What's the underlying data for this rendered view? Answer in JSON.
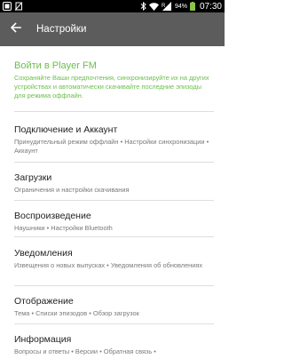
{
  "status_bar": {
    "time": "07:30",
    "battery_percent": "94%",
    "left_icons": [
      "notification-icon",
      "no-sim-icon"
    ],
    "right_icons": [
      "bluetooth-icon",
      "wifi-icon",
      "signal-icon",
      "battery-icon"
    ],
    "signal_roaming_mark": "R"
  },
  "app_bar": {
    "back_icon": "arrow-left-icon",
    "title": "Настройки"
  },
  "signin": {
    "title": "Войти в Player FM",
    "description": "Сохраняйте Ваши предпочтения, синхронизируйте их на других устройствах и автоматически скачивайте последние эпизоды для режима оффлайн."
  },
  "settings": [
    {
      "title": "Подключение и Аккаунт",
      "subtitle": "Принудительный режим оффлайн • Настройки синхронизации • Аккаунт"
    },
    {
      "title": "Загрузки",
      "subtitle": "Ограничения и настройки скачивания"
    },
    {
      "title": "Воспроизведение",
      "subtitle": "Наушники • Настройки Bluetooth"
    },
    {
      "title": "Уведомления",
      "subtitle": "Извещения о новых выпусках • Уведомления об обновлениях"
    },
    {
      "title": "Отображение",
      "subtitle": "Тема • Списки эпизодов • Обзор загрузок"
    },
    {
      "title": "Информация",
      "subtitle": "Вопросы и ответы • Версии • Обратная связь •"
    }
  ],
  "colors": {
    "accent": "#6bc04b",
    "app_bar": "#5c5c5c",
    "status_bar": "#000000",
    "battery": "#8bc34a"
  }
}
